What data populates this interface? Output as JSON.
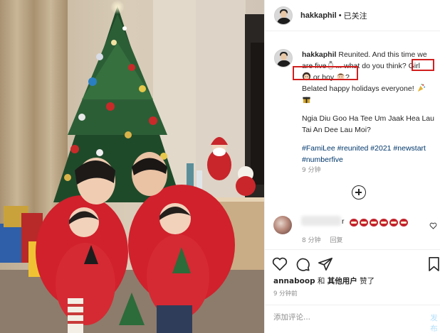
{
  "post": {
    "username": "hakkaphil",
    "separator": "•",
    "follow_status": "已关注"
  },
  "caption": {
    "username": "hakkaphil",
    "line1": "Reunited. And this time we",
    "line2a": "are five",
    "line2b": "... what do you think?",
    "girl": "Girl",
    "or_boy": "or boy",
    "question": "?",
    "line4": "Belated happy holidays everyone!",
    "para2_line1": "Ngia Diu Goo Ha Tee Um Jaak Hea Lau",
    "para2_line2": "Tai An Dee Lau Moi?",
    "hashtags_line1": "#FamiLee #reunited #2021 #newstart",
    "hashtags_line2": "#numberfive",
    "time": "9 分钟"
  },
  "second_comment": {
    "name_fragment": "r",
    "time": "8 分钟",
    "reply_label": "回复"
  },
  "actions": {
    "like_icon": "heart-icon",
    "comment_icon": "comment-icon",
    "share_icon": "paper-plane-icon",
    "save_icon": "bookmark-icon"
  },
  "likes": {
    "user": "annaboop",
    "and": " 和 ",
    "others": "其他用户",
    "liked": " 赞了"
  },
  "post_time": "9 分钟前",
  "comment_box": {
    "placeholder": "添加评论...",
    "post_label": "发布"
  },
  "colors": {
    "highlight_box": "#d21f1f",
    "hashtag": "#00376b",
    "muted": "#8e8e8e",
    "post_button": "#b2dffc"
  }
}
